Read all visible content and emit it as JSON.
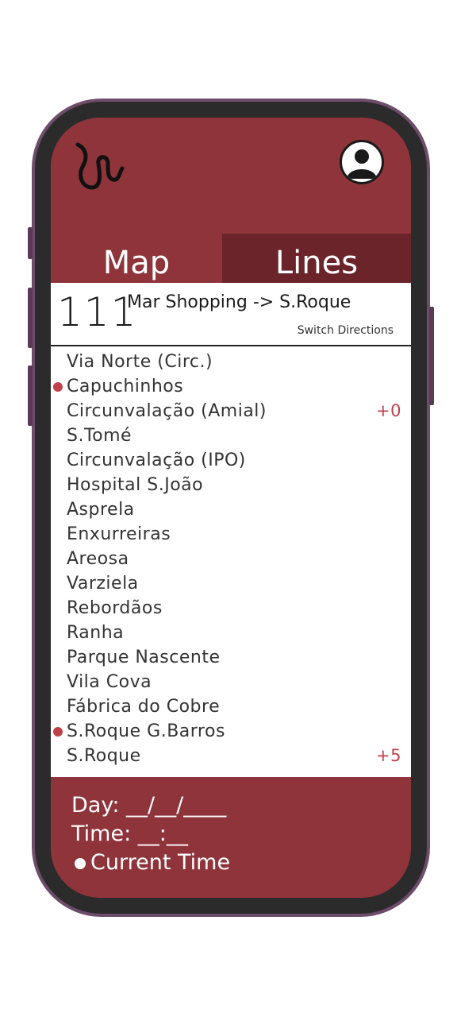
{
  "header": {
    "logo": "squiggle-logo-icon",
    "avatar": "user-avatar-icon"
  },
  "tabs": [
    {
      "label": "Map",
      "active": false
    },
    {
      "label": "Lines",
      "active": true
    }
  ],
  "line": {
    "number": "111",
    "route": "Mar Shopping -> S.Roque",
    "switch_label": "Switch Directions"
  },
  "stops": [
    {
      "name": "Via Norte (Circ.)",
      "marked": false,
      "delay": ""
    },
    {
      "name": "Capuchinhos",
      "marked": true,
      "delay": ""
    },
    {
      "name": "Circunvalação (Amial)",
      "marked": false,
      "delay": "+0"
    },
    {
      "name": "S.Tomé",
      "marked": false,
      "delay": ""
    },
    {
      "name": "Circunvalação (IPO)",
      "marked": false,
      "delay": ""
    },
    {
      "name": "Hospital S.João",
      "marked": false,
      "delay": ""
    },
    {
      "name": "Asprela",
      "marked": false,
      "delay": ""
    },
    {
      "name": "Enxurreiras",
      "marked": false,
      "delay": ""
    },
    {
      "name": "Areosa",
      "marked": false,
      "delay": ""
    },
    {
      "name": "Varziela",
      "marked": false,
      "delay": ""
    },
    {
      "name": "Rebordãos",
      "marked": false,
      "delay": ""
    },
    {
      "name": "Ranha",
      "marked": false,
      "delay": ""
    },
    {
      "name": "Parque Nascente",
      "marked": false,
      "delay": ""
    },
    {
      "name": "Vila Cova",
      "marked": false,
      "delay": ""
    },
    {
      "name": "Fábrica do Cobre",
      "marked": false,
      "delay": ""
    },
    {
      "name": "S.Roque G.Barros",
      "marked": true,
      "delay": ""
    },
    {
      "name": "S.Roque",
      "marked": false,
      "delay": "+5"
    }
  ],
  "footer": {
    "day_label": "Day: __/__/____",
    "time_label": "Time: __:__",
    "current_time_label": "Current Time"
  },
  "colors": {
    "brand": "#8f343b",
    "tab_active": "#6a242a",
    "accent": "#c0414b"
  }
}
